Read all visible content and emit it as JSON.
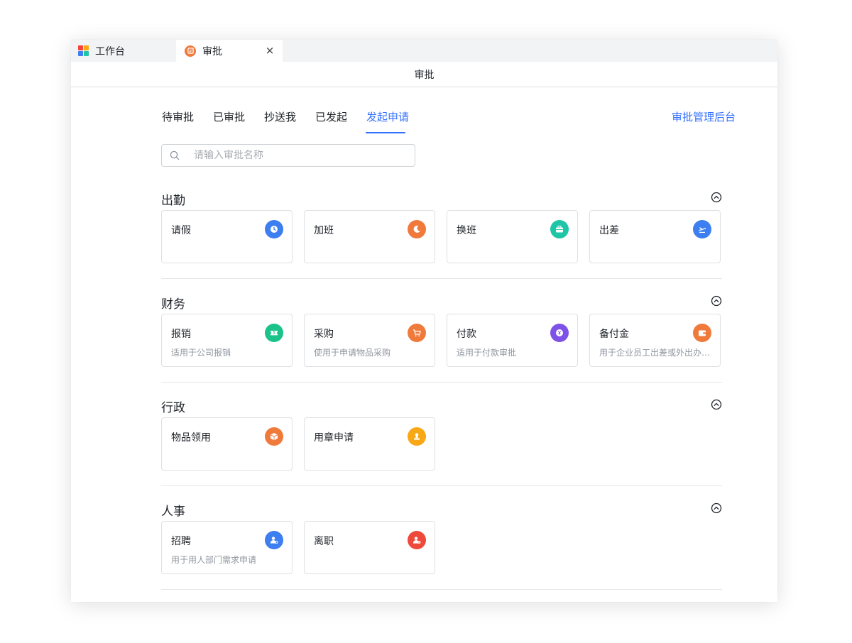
{
  "tabs": {
    "home_label": "工作台",
    "active_label": "审批",
    "close_symbol": "×"
  },
  "page_title": "审批",
  "nav": {
    "items": [
      "待审批",
      "已审批",
      "抄送我",
      "已发起",
      "发起申请"
    ],
    "active_index": 4,
    "admin_link": "审批管理后台"
  },
  "search": {
    "placeholder": "请输入审批名称",
    "value": ""
  },
  "sections": [
    {
      "title": "出勤",
      "cards": [
        {
          "title": "请假",
          "desc": "",
          "icon": "clock-icon",
          "color": "#3d7ef0"
        },
        {
          "title": "加班",
          "desc": "",
          "icon": "moon-icon",
          "color": "#f07a3c"
        },
        {
          "title": "换班",
          "desc": "",
          "icon": "briefcase-icon",
          "color": "#1ec5a6"
        },
        {
          "title": "出差",
          "desc": "",
          "icon": "airplane-icon",
          "color": "#3d7ef0"
        }
      ]
    },
    {
      "title": "财务",
      "cards": [
        {
          "title": "报销",
          "desc": "适用于公司报销",
          "icon": "ticket-icon",
          "color": "#1bc38a"
        },
        {
          "title": "采购",
          "desc": "使用于申请物品采购",
          "icon": "cart-icon",
          "color": "#f07a3c"
        },
        {
          "title": "付款",
          "desc": "适用于付款审批",
          "icon": "coin-icon",
          "color": "#7e52e8"
        },
        {
          "title": "备付金",
          "desc": "用于企业员工出差或外出办公使用",
          "icon": "wallet-icon",
          "color": "#f07a3c"
        }
      ]
    },
    {
      "title": "行政",
      "cards": [
        {
          "title": "物品领用",
          "desc": "",
          "icon": "box-icon",
          "color": "#f07a3c"
        },
        {
          "title": "用章申请",
          "desc": "",
          "icon": "stamp-icon",
          "color": "#f7a814"
        }
      ]
    },
    {
      "title": "人事",
      "cards": [
        {
          "title": "招聘",
          "desc": "用于用人部门需求申请",
          "icon": "user-add-icon",
          "color": "#3d7ef0"
        },
        {
          "title": "离职",
          "desc": "",
          "icon": "user-remove-icon",
          "color": "#ed4a3c"
        }
      ]
    }
  ],
  "colors": {
    "accent": "#3370ff",
    "logo": [
      "#f5423d",
      "#f7a814",
      "#3d7ef0",
      "#1ec5a6"
    ]
  }
}
